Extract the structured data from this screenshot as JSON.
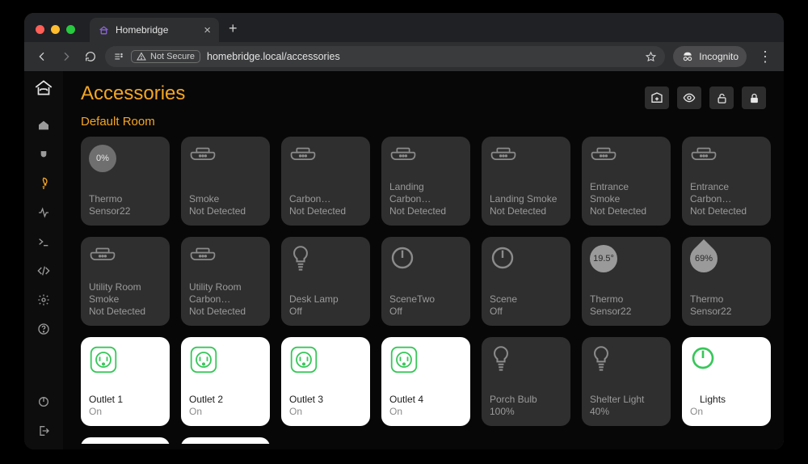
{
  "browser": {
    "tab_title": "Homebridge",
    "not_secure_label": "Not Secure",
    "url_display": "homebridge.local/accessories",
    "incognito_label": "Incognito"
  },
  "page": {
    "title": "Accessories",
    "room_title": "Default Room"
  },
  "tiles": [
    {
      "name1": "Thermo",
      "name2": "Sensor22",
      "state": "",
      "badge": "0%",
      "type": "thermo"
    },
    {
      "name1": "Smoke",
      "name2": "Not Detected",
      "state": "",
      "type": "smoke"
    },
    {
      "name1": "Carbon…",
      "name2": "Not Detected",
      "state": "",
      "type": "smoke"
    },
    {
      "name1": "Landing",
      "name2": "Carbon…",
      "state": "Not Detected",
      "type": "smoke"
    },
    {
      "name1": "Landing Smoke",
      "name2": "Not Detected",
      "state": "",
      "type": "smoke"
    },
    {
      "name1": "Entrance",
      "name2": "Smoke",
      "state": "Not Detected",
      "type": "smoke"
    },
    {
      "name1": "Entrance",
      "name2": "Carbon…",
      "state": "Not Detected",
      "type": "smoke"
    },
    {
      "name1": "Utility Room",
      "name2": "Smoke",
      "state": "Not Detected",
      "type": "smoke"
    },
    {
      "name1": "Utility Room",
      "name2": "Carbon…",
      "state": "Not Detected",
      "type": "smoke"
    },
    {
      "name1": "Desk Lamp",
      "name2": "Off",
      "state": "",
      "type": "bulb"
    },
    {
      "name1": "SceneTwo",
      "name2": "Off",
      "state": "",
      "type": "power"
    },
    {
      "name1": "Scene",
      "name2": "Off",
      "state": "",
      "type": "power"
    },
    {
      "name1": "Thermo",
      "name2": "Sensor22",
      "state": "",
      "badge": "19.5°",
      "type": "thermo-light"
    },
    {
      "name1": "Thermo",
      "name2": "Sensor22",
      "state": "",
      "badge": "69%",
      "type": "drop"
    },
    {
      "name1": "Outlet 1",
      "name2": "On",
      "state": "",
      "on": true,
      "type": "outlet"
    },
    {
      "name1": "Outlet 2",
      "name2": "On",
      "state": "",
      "on": true,
      "type": "outlet"
    },
    {
      "name1": "Outlet 3",
      "name2": "On",
      "state": "",
      "on": true,
      "type": "outlet"
    },
    {
      "name1": "Outlet 4",
      "name2": "On",
      "state": "",
      "on": true,
      "type": "outlet"
    },
    {
      "name1": "Porch Bulb",
      "name2": "100%",
      "state": "",
      "type": "bulb"
    },
    {
      "name1": "Shelter Light",
      "name2": "40%",
      "state": "",
      "type": "bulb"
    },
    {
      "name1": "Lights",
      "name2": "On",
      "state": "",
      "on": true,
      "type": "power-on"
    }
  ]
}
